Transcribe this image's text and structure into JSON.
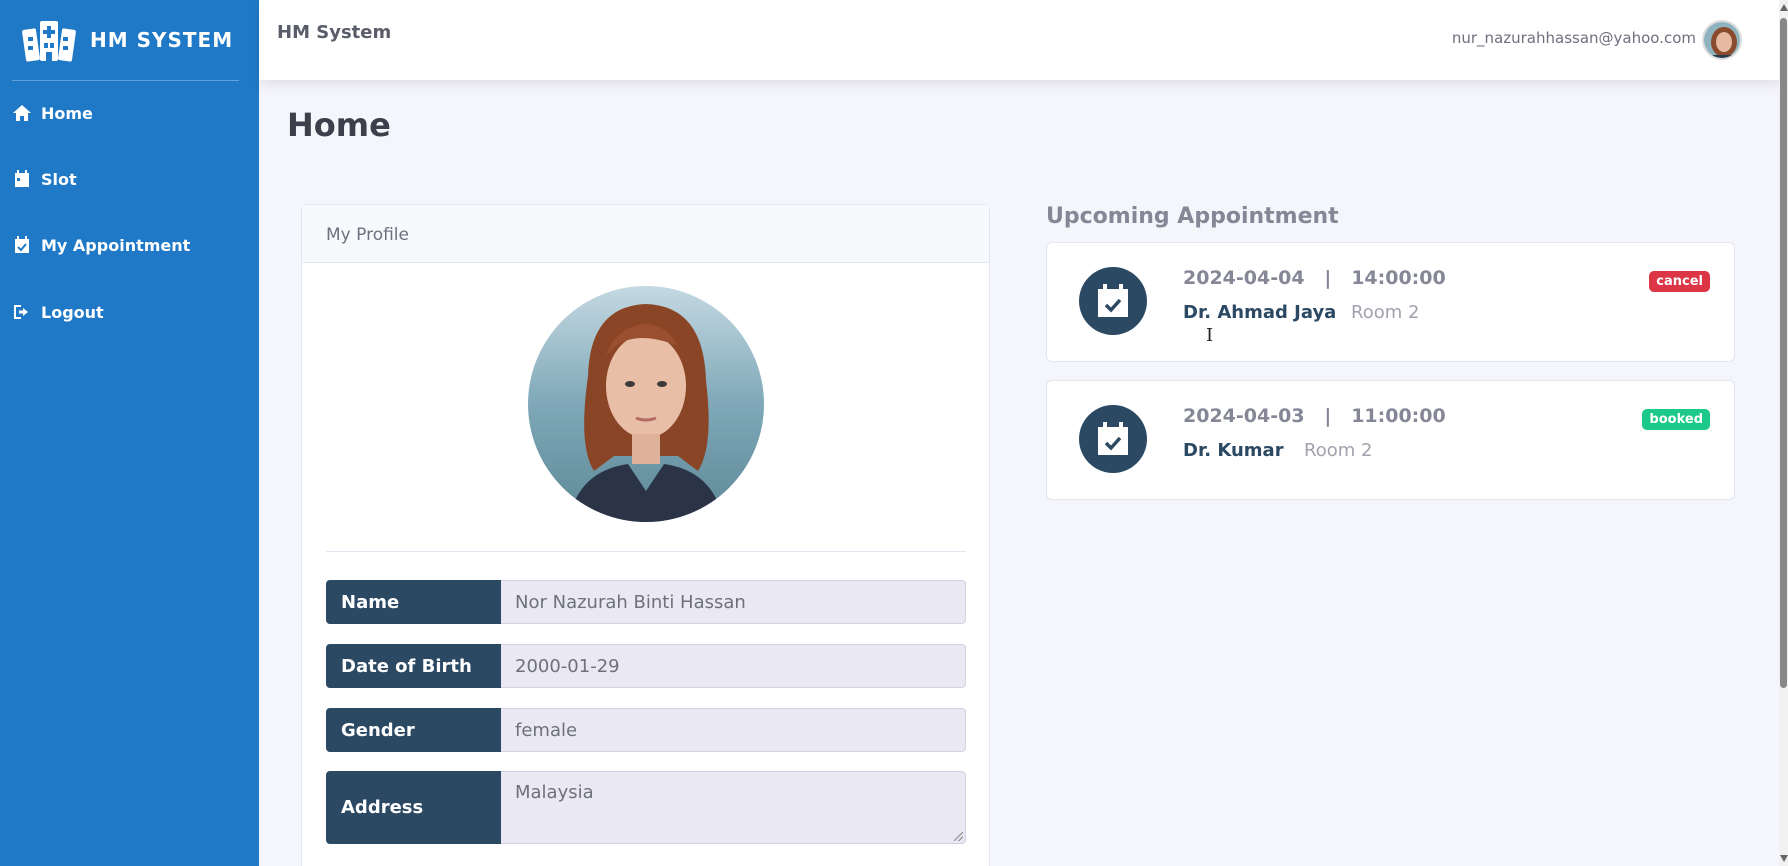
{
  "brand": {
    "name": "HM SYSTEM"
  },
  "sidebar": {
    "items": [
      {
        "label": "Home",
        "icon": "home-icon"
      },
      {
        "label": "Slot",
        "icon": "calendar-icon"
      },
      {
        "label": "My Appointment",
        "icon": "calendar-check-icon"
      },
      {
        "label": "Logout",
        "icon": "logout-icon"
      }
    ]
  },
  "topbar": {
    "title": "HM System",
    "user_email": "nur_nazurahhassan@yahoo.com"
  },
  "page": {
    "title": "Home"
  },
  "profile": {
    "header": "My Profile",
    "fields": [
      {
        "label": "Name",
        "value": "Nor Nazurah Binti Hassan"
      },
      {
        "label": "Date of Birth",
        "value": "2000-01-29"
      },
      {
        "label": "Gender",
        "value": "female"
      },
      {
        "label": "Address",
        "value": "Malaysia"
      }
    ]
  },
  "appointments": {
    "heading": "Upcoming Appointment",
    "items": [
      {
        "date": "2024-04-04",
        "time": "14:00:00",
        "doctor": "Dr. Ahmad Jaya",
        "room": "Room 2",
        "status": "cancel",
        "status_color": "#dc3545"
      },
      {
        "date": "2024-04-03",
        "time": "11:00:00",
        "doctor": "Dr. Kumar",
        "room": "Room 2",
        "status": "booked",
        "status_color": "#1cc88a"
      }
    ]
  },
  "colors": {
    "sidebar": "#2079c7",
    "label_bg": "#2c4964",
    "page_bg": "#f5f6fb"
  }
}
